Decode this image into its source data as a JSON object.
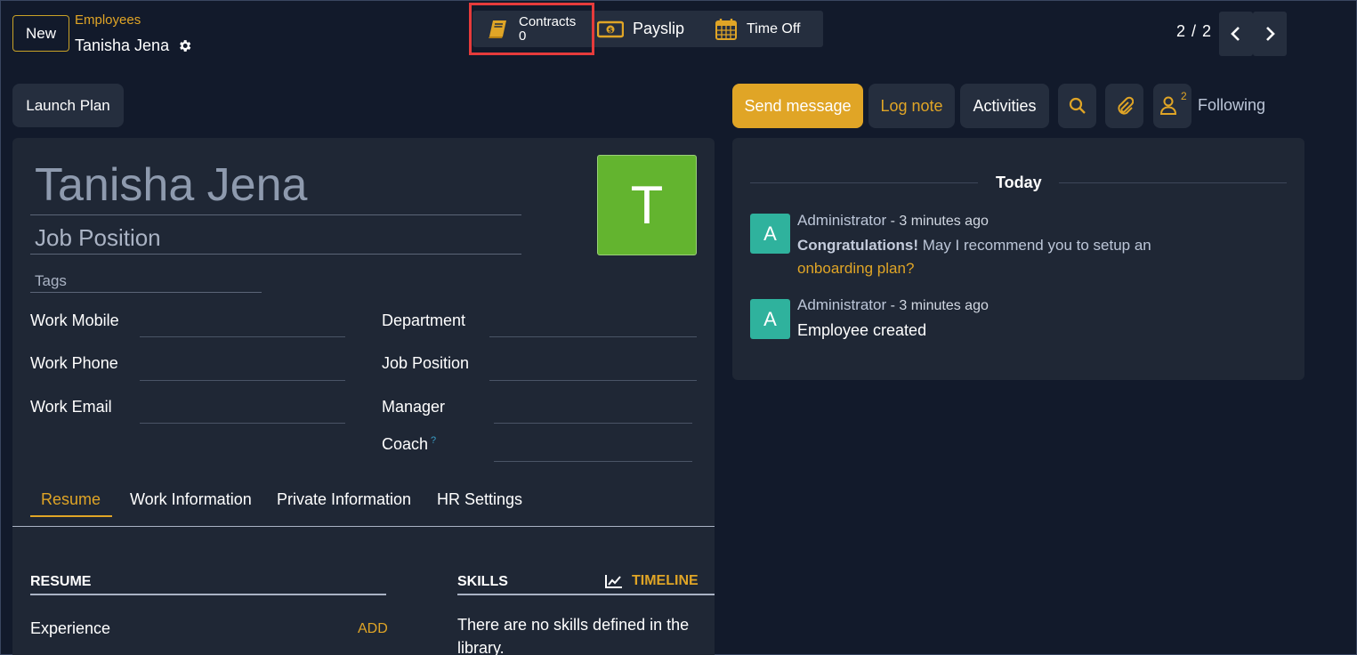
{
  "control_panel": {
    "new_label": "New",
    "breadcrumb": "Employees",
    "record_name": "Tanisha Jena",
    "pager": "2 / 2"
  },
  "smart_buttons": {
    "contracts_label": "Contracts",
    "contracts_count": "0",
    "payslip_label": "Payslip",
    "timeoff_label": "Time Off"
  },
  "actions": {
    "launch_plan": "Launch Plan",
    "send_message": "Send message",
    "log_note": "Log note",
    "activities": "Activities",
    "follower_count": "2",
    "following": "Following"
  },
  "employee": {
    "name": "Tanisha Jena",
    "job_position_placeholder": "Job Position",
    "tags_placeholder": "Tags",
    "avatar_letter": "T",
    "avatar_color": "#63b42f"
  },
  "fields": {
    "work_mobile": "Work Mobile",
    "work_phone": "Work Phone",
    "work_email": "Work Email",
    "department": "Department",
    "job_position": "Job Position",
    "manager": "Manager",
    "coach": "Coach",
    "coach_help": "?"
  },
  "tabs": [
    "Resume",
    "Work Information",
    "Private Information",
    "HR Settings"
  ],
  "resume": {
    "resume_title": "RESUME",
    "skills_title": "SKILLS",
    "timeline": "TIMELINE",
    "experience": "Experience",
    "add": "ADD",
    "no_skills": "There are no skills defined in the library."
  },
  "chatter": {
    "today": "Today",
    "messages": [
      {
        "avatar": "A",
        "author": "Administrator",
        "time": "- 3 minutes ago",
        "bold": "Congratulations!",
        "text": " May I recommend you to setup an ",
        "link": "onboarding plan?"
      },
      {
        "avatar": "A",
        "author": "Administrator",
        "time": "- 3 minutes ago",
        "text": "Employee created"
      }
    ]
  },
  "colors": {
    "accent": "#e0a526",
    "background": "#121a2b",
    "panel": "#1f2735",
    "highlight": "#e63b3b",
    "chat_avatar": "#2fb29d"
  }
}
